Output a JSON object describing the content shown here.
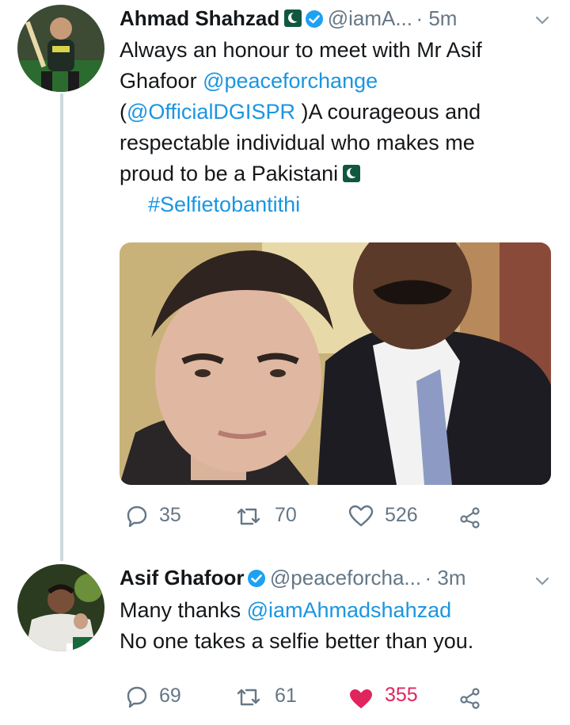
{
  "tweets": [
    {
      "name": "Ahmad Shahzad",
      "handle": "@iamA...",
      "time": "· 5m",
      "text_line1": "Always an honour to meet with Mr Asif",
      "text_line2_a": "Ghafoor ",
      "text_line2_link": "@peaceforchange",
      "text_line3_a": "(",
      "text_line3_link": "@OfficialDGISPR",
      "text_line3_b": " )A courageous and",
      "text_line4": "respectable individual who makes me",
      "text_line5": "proud to be a Pakistani",
      "hashtag": "#Selfietobantithi",
      "replies": "35",
      "retweets": "70",
      "likes": "526"
    },
    {
      "name": "Asif Ghafoor",
      "handle": "@peaceforcha...",
      "time": "· 3m",
      "text_line1_a": "Many thanks ",
      "text_line1_link": "@iamAhmadshahzad",
      "text_line2": "No one takes a selfie better than you.",
      "replies": "69",
      "retweets": "61",
      "likes": "355"
    }
  ],
  "icons": [
    "reply-icon",
    "retweet-icon",
    "like-icon",
    "share-icon",
    "verified-icon",
    "flag-icon",
    "chevron-down-icon"
  ],
  "colors": {
    "link": "#1b95e0",
    "meta": "#657786",
    "liked": "#e0245e",
    "verified": "#1da1f2"
  }
}
